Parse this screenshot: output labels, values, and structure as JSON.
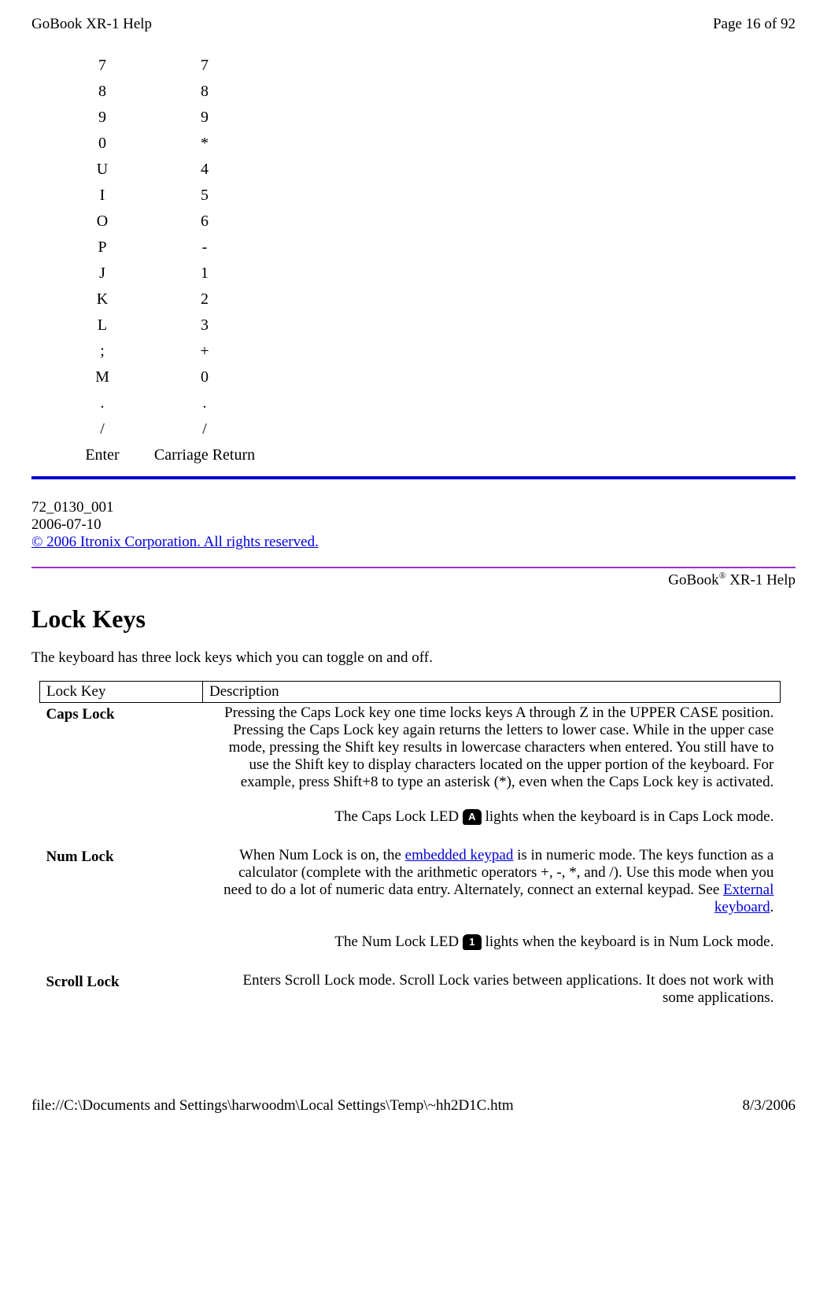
{
  "header": {
    "title": "GoBook XR-1 Help",
    "page": "Page 16 of 92"
  },
  "keymap": [
    {
      "k": "7",
      "v": "7"
    },
    {
      "k": "8",
      "v": "8"
    },
    {
      "k": "9",
      "v": "9"
    },
    {
      "k": "0",
      "v": "*"
    },
    {
      "k": "U",
      "v": "4"
    },
    {
      "k": "I",
      "v": "5"
    },
    {
      "k": "O",
      "v": "6"
    },
    {
      "k": "P",
      "v": "-"
    },
    {
      "k": "J",
      "v": "1"
    },
    {
      "k": "K",
      "v": "2"
    },
    {
      "k": "L",
      "v": "3"
    },
    {
      "k": ";",
      "v": "+"
    },
    {
      "k": "M",
      "v": "0"
    },
    {
      "k": ".",
      "v": "."
    },
    {
      "k": "/",
      "v": "/"
    },
    {
      "k": "Enter",
      "v": "Carriage Return"
    }
  ],
  "docmeta": {
    "id": "72_0130_001",
    "date": "2006-07-10",
    "copyright": "© 2006 Itronix Corporation. All rights reserved."
  },
  "brand": {
    "prefix": "GoBook",
    "reg": "®",
    "suffix": " XR-1 Help"
  },
  "section": {
    "title": "Lock Keys",
    "intro": "The keyboard has three lock keys which you can toggle on and off."
  },
  "table_headers": {
    "c1": "Lock Key",
    "c2": "Description"
  },
  "caps": {
    "label": "Caps Lock",
    "p1": "Pressing the Caps Lock key one time locks keys A through Z in the UPPER CASE position. Pressing the Caps Lock key again returns the letters to lower case. While in the upper case mode, pressing the Shift key results in lowercase characters when entered. You still have to use the Shift key to display characters located on the upper portion of the keyboard. For example, press Shift+8 to type an asterisk (*), even when the Caps Lock key is activated.",
    "p2a": "The Caps Lock LED ",
    "icon": "A",
    "p2b": " lights when the keyboard is in Caps Lock mode."
  },
  "num": {
    "label": "Num Lock",
    "p1a": "When Num Lock is on, the ",
    "link1": "embedded keypad",
    "p1b": " is in numeric mode. The keys function as a calculator (complete with the arithmetic operators +, -, *, and /). Use this mode when you need to do a lot of numeric data entry. Alternately, connect an external keypad. See ",
    "link2": "External keyboard",
    "p1c": ".",
    "p2a": "The Num Lock LED ",
    "icon": "1",
    "p2b": " lights when the keyboard is in Num Lock mode."
  },
  "scroll": {
    "label": "Scroll Lock",
    "p1": "Enters Scroll Lock mode. Scroll Lock varies between applications. It does not work with some applications."
  },
  "footer": {
    "path": "file://C:\\Documents and Settings\\harwoodm\\Local Settings\\Temp\\~hh2D1C.htm",
    "date": "8/3/2006"
  }
}
